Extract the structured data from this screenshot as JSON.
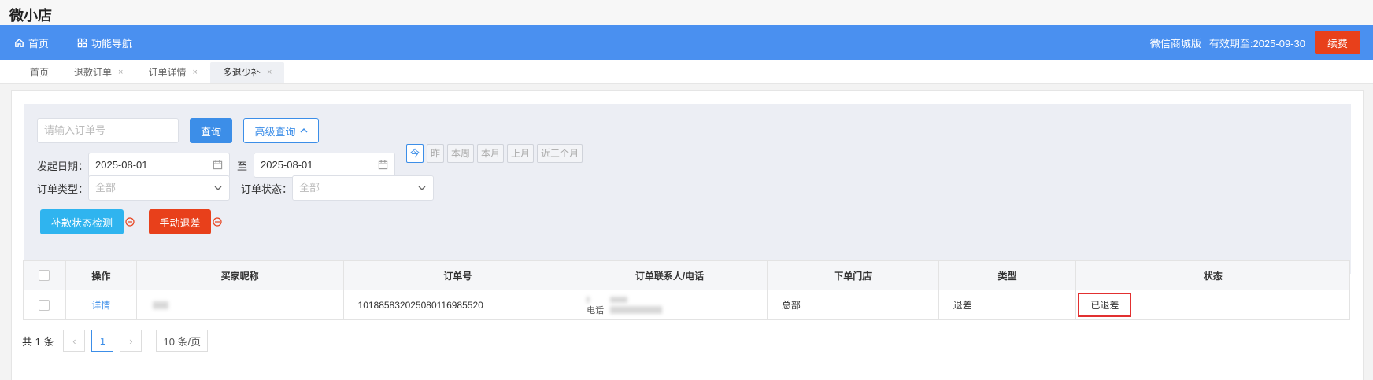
{
  "app": {
    "title": "微小店"
  },
  "topbar": {
    "nav": [
      {
        "label": "首页",
        "icon": "home-icon"
      },
      {
        "label": "功能导航",
        "icon": "apps-icon"
      }
    ],
    "edition": "微信商城版",
    "expiry": "有效期至:2025-09-30",
    "renew_label": "续费",
    "colors": {
      "bar": "#4a90f0",
      "renew": "#e8401b"
    }
  },
  "tabs": [
    {
      "label": "首页",
      "closable": false,
      "active": false
    },
    {
      "label": "退款订单",
      "closable": true,
      "active": false
    },
    {
      "label": "订单详情",
      "closable": true,
      "active": false
    },
    {
      "label": "多退少补",
      "closable": true,
      "active": true
    }
  ],
  "tab_close_glyph": "×",
  "filter": {
    "order_no_placeholder": "请输入订单号",
    "search_label": "查询",
    "advanced_label": "高级查询",
    "date_label": "发起日期：",
    "date_from": "2025-08-01",
    "date_sep": "至",
    "date_to": "2025-08-01",
    "quick_dates": [
      {
        "label": "今",
        "active": true
      },
      {
        "label": "昨",
        "active": false
      },
      {
        "label": "本周",
        "active": false
      },
      {
        "label": "本月",
        "active": false
      },
      {
        "label": "上月",
        "active": false
      },
      {
        "label": "近三个月",
        "active": false
      }
    ],
    "order_type_label": "订单类型：",
    "order_type_value": "全部",
    "order_status_label": "订单状态：",
    "order_status_value": "全部",
    "check_button": "补款状态检测",
    "manual_button": "手动退差"
  },
  "table": {
    "columns": [
      "操作",
      "买家昵称",
      "订单号",
      "订单联系人/电话",
      "下单门店",
      "类型",
      "状态"
    ],
    "rows": [
      {
        "action": "详情",
        "order_no": "1018858320250801169855​20",
        "contact_phone_label": "电话",
        "store": "总部",
        "type": "退差",
        "status": "已退差"
      }
    ]
  },
  "pager": {
    "total": "共 1 条",
    "prev": "‹",
    "current": "1",
    "next": "›",
    "page_size": "10 条/页"
  }
}
